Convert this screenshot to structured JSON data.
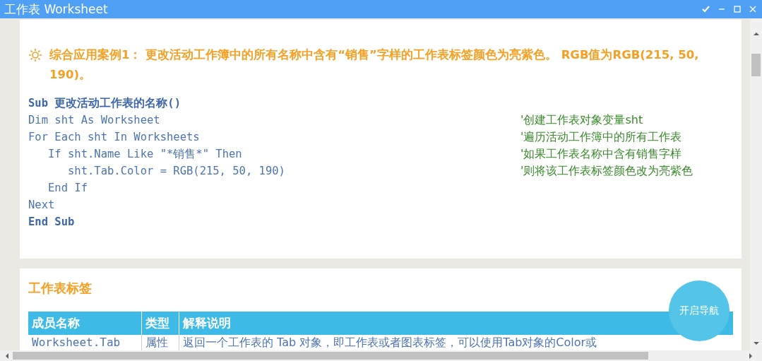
{
  "window": {
    "title": "工作表 Worksheet"
  },
  "example": {
    "heading": "综合应用案例1：  更改活动工作簿中的所有名称中含有“销售”字样的工作表标签颜色为亮紫色。  RGB值为RGB(215, 50, 190)。",
    "code": [
      {
        "kind": "bold",
        "text": "Sub 更改活动工作表的名称()"
      },
      {
        "kind": "plain",
        "text": "Dim sht As Worksheet",
        "comment": "'创建工作表对象变量sht"
      },
      {
        "kind": "plain",
        "text": "For Each sht In Worksheets",
        "comment": "'遍历活动工作簿中的所有工作表"
      },
      {
        "kind": "plain",
        "text": "   If sht.Name Like \"*销售*\" Then",
        "comment": "'如果工作表名称中含有销售字样"
      },
      {
        "kind": "plain",
        "text": "      sht.Tab.Color = RGB(215, 50, 190)",
        "comment": "'则将该工作表标签颜色改为亮紫色"
      },
      {
        "kind": "plain",
        "text": "   End If"
      },
      {
        "kind": "plain",
        "text": "Next"
      },
      {
        "kind": "bold",
        "text": "End Sub"
      }
    ]
  },
  "section": {
    "title": "工作表标签",
    "table": {
      "columns": [
        "成员名称",
        "类型",
        "解释说明"
      ],
      "rows": [
        [
          "Worksheet.Tab",
          "属性",
          "返回一个工作表的 Tab 对象，即工作表或者图表标签，可以使用Tab对象的Color或"
        ]
      ]
    }
  },
  "nav_button": {
    "label": "开启导航"
  }
}
